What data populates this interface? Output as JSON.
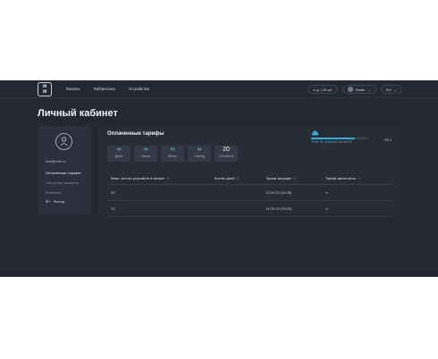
{
  "app": {
    "logo_line1": "VR",
    "logo_line2": "VR"
  },
  "nav": {
    "items": [
      "Каналы",
      "Библиотека",
      "Устройства"
    ]
  },
  "header": {
    "balance": "∞ д. | 20 шт",
    "username": "Tester",
    "language": "RU"
  },
  "page": {
    "title": "Личный кабинет"
  },
  "sidebar": {
    "email": "test@mail.ru",
    "menu": [
      "Оплаченные тарифы",
      "Настройки аккаунта",
      "Контакты"
    ],
    "logout": "Выход"
  },
  "tariffs": {
    "title": "Оплаченные тарифы",
    "tiles": [
      {
        "value": "∞",
        "label": "Дней"
      },
      {
        "value": "∞",
        "label": "Часов"
      },
      {
        "value": "∞",
        "label": "Минут"
      },
      {
        "value": "∞",
        "label": "Секунд"
      },
      {
        "value": "20",
        "label": "Устройств"
      }
    ],
    "storage_used": "75.85 ТБ загружено",
    "storage_total": "из 100 ТБ",
    "storage_fraction": 0.76,
    "lang_chip": "RU ▾",
    "columns": [
      "Макс. кол-во устройств в канале",
      "Кол-во дней",
      "Тариф запущен",
      "Тариф закончится"
    ],
    "rows": [
      [
        "10",
        "",
        "13.04.23 (18:25)",
        "∞"
      ],
      [
        "10",
        "",
        "14.05.10 (15:25)",
        "∞"
      ]
    ]
  },
  "colors": {
    "background": "#232933",
    "accent": "#5ac8e8"
  }
}
